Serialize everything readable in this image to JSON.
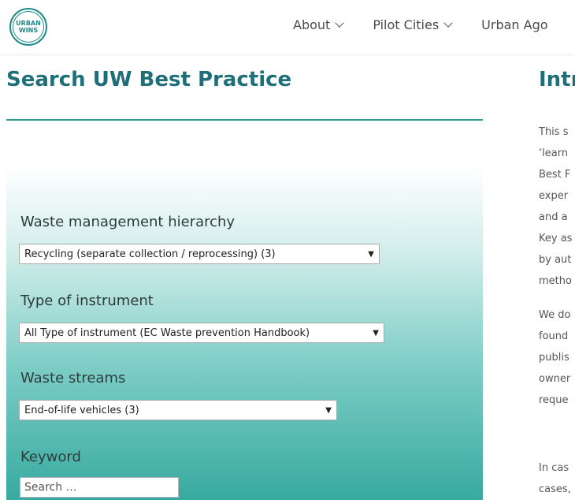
{
  "header": {
    "logo_lines": [
      "URBAN",
      "WINS"
    ],
    "nav": [
      {
        "label": "About"
      },
      {
        "label": "Pilot Cities"
      },
      {
        "label": "Urban Ago"
      }
    ]
  },
  "left": {
    "title": "Search UW Best Practice",
    "filters": {
      "hierarchy": {
        "label": "Waste management hierarchy",
        "selected": "Recycling (separate collection / reprocessing)  (3)"
      },
      "instrument": {
        "label": "Type of instrument",
        "selected": "All Type of instrument (EC Waste prevention Handbook)"
      },
      "streams": {
        "label": "Waste streams",
        "selected": "End-of-life vehicles  (3)"
      },
      "keyword": {
        "label": "Keyword",
        "placeholder": "Search …"
      }
    }
  },
  "right": {
    "title": "Intr",
    "paragraph1": [
      "This s",
      "‘learn",
      "Best F",
      "exper",
      "and a",
      "Key as",
      "by aut",
      "metho"
    ],
    "paragraph2": [
      "We do",
      "found",
      "publis",
      "owner",
      "reque"
    ],
    "paragraph3": [
      "In cas",
      "cases,"
    ]
  }
}
